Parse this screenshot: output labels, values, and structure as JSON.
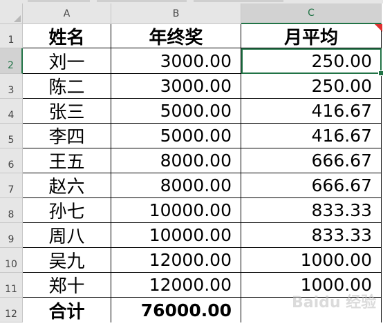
{
  "columns": [
    "A",
    "B",
    "C"
  ],
  "active_column": "C",
  "active_row": "2",
  "rows": [
    {
      "row": "1",
      "name": "姓名",
      "bonus": "年终奖",
      "monthly": "月平均",
      "header": true
    },
    {
      "row": "2",
      "name": "刘一",
      "bonus": "3000.00",
      "monthly": "250.00"
    },
    {
      "row": "3",
      "name": "陈二",
      "bonus": "3000.00",
      "monthly": "250.00"
    },
    {
      "row": "4",
      "name": "张三",
      "bonus": "5000.00",
      "monthly": "416.67"
    },
    {
      "row": "5",
      "name": "李四",
      "bonus": "5000.00",
      "monthly": "416.67"
    },
    {
      "row": "6",
      "name": "王五",
      "bonus": "8000.00",
      "monthly": "666.67"
    },
    {
      "row": "7",
      "name": "赵六",
      "bonus": "8000.00",
      "monthly": "666.67"
    },
    {
      "row": "8",
      "name": "孙七",
      "bonus": "10000.00",
      "monthly": "833.33"
    },
    {
      "row": "9",
      "name": "周八",
      "bonus": "10000.00",
      "monthly": "833.33"
    },
    {
      "row": "10",
      "name": "吴九",
      "bonus": "12000.00",
      "monthly": "1000.00"
    },
    {
      "row": "11",
      "name": "郑十",
      "bonus": "12000.00",
      "monthly": "1000.00"
    },
    {
      "row": "12",
      "name": "合计",
      "bonus": "76000.00",
      "monthly": "",
      "total": true
    }
  ],
  "watermark": "Baidu 经验",
  "colors": {
    "selection": "#217346",
    "comment": "#e03030"
  }
}
